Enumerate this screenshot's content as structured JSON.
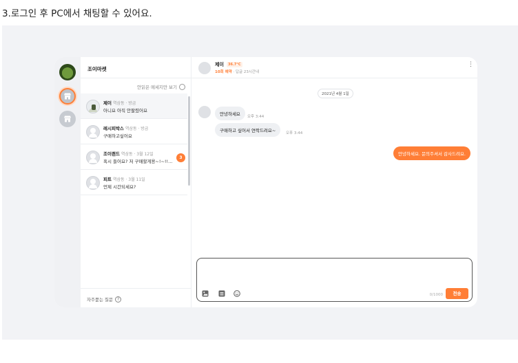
{
  "caption": "3.로그인 후 PC에서 채팅할 수 있어요.",
  "colors": {
    "accent": "#ff7e36",
    "stage": "#f2f3f6"
  },
  "rail": {
    "items": [
      {
        "name": "profile-avatar"
      },
      {
        "name": "store-icon",
        "selected": true
      },
      {
        "name": "store-icon"
      }
    ]
  },
  "list": {
    "title": "조이마켓",
    "unread_filter": "안읽은 메세지만 보기",
    "faq": "자주묻는 질문",
    "faq_icon": "?",
    "rows": [
      {
        "name": "제이",
        "meta": "역삼동 · 방금",
        "message": "아니요 아직 안팔렸어요",
        "photo": true,
        "active": true
      },
      {
        "name": "레시피박스",
        "meta": "역삼동 · 방금",
        "message": "구매하고싶어요"
      },
      {
        "name": "조이랜드",
        "meta": "역삼동 · 3월 12일",
        "message": "혹시 들어요? 저 구매할게용~!~!!...",
        "badge": "3"
      },
      {
        "name": "피트",
        "meta": "역삼동 · 3월 11일",
        "message": "언제 시간되세요?"
      }
    ]
  },
  "chat": {
    "name": "제이",
    "temperature": "36.7°C",
    "response_highlight": "10회 예약",
    "response_rest": "· 답글 23시간내",
    "more_icon": "⋮",
    "date": "2021년 4월 1일",
    "messages": [
      {
        "dir": "in",
        "text": "안녕하세요",
        "time": "오후 3:44"
      },
      {
        "dir": "in",
        "text": "구매하고 싶어서 연락드려요~",
        "time": "오후 3:44"
      },
      {
        "dir": "out",
        "text": "안녕하세요. 문의주셔서 감사드려요."
      }
    ],
    "composer": {
      "count": "0/1000",
      "send_label": "전송"
    }
  }
}
